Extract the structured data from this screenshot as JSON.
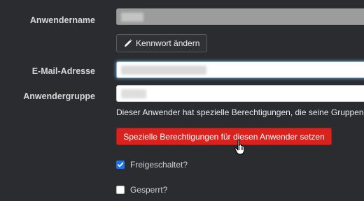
{
  "form": {
    "username": {
      "label": "Anwendername"
    },
    "change_password_button": "Kennwort ändern",
    "email": {
      "label": "E-Mail-Adresse"
    },
    "usergroup": {
      "label": "Anwendergruppe"
    },
    "special_permissions_note": "Dieser Anwender hat spezielle Berechtigungen, die seine Gruppenb",
    "special_permissions_button": "Spezielle Berechtigungen für diesen Anwender setzen",
    "enabled": {
      "label": "Freigeschaltet?",
      "checked": true
    },
    "locked": {
      "label": "Gesperrt?",
      "checked": false
    }
  },
  "colors": {
    "page_bg": "#2b2c30",
    "accent_red": "#d9211d",
    "checkbox_blue": "#1a73e8"
  },
  "icons": {
    "edit": "pencil-icon",
    "cursor": "hand-pointer-icon"
  }
}
